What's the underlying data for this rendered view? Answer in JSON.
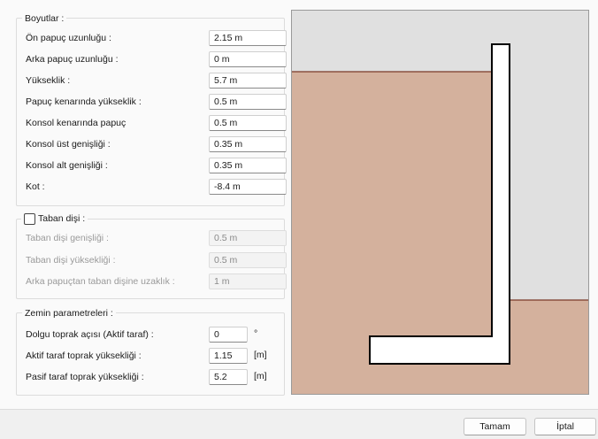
{
  "dimensions": {
    "title": "Boyutlar :",
    "fields": [
      {
        "label": "Ön papuç uzunluğu :",
        "value": "2.15 m"
      },
      {
        "label": "Arka papuç uzunluğu :",
        "value": "0 m"
      },
      {
        "label": "Yükseklik :",
        "value": "5.7 m"
      },
      {
        "label": "Papuç kenarında yükseklik :",
        "value": "0.5 m"
      },
      {
        "label": "Konsol kenarında papuç",
        "value": "0.5 m"
      },
      {
        "label": "Konsol üst genişliği :",
        "value": "0.35 m"
      },
      {
        "label": "Konsol alt genişliği :",
        "value": "0.35 m"
      },
      {
        "label": "Kot :",
        "value": "-8.4 m"
      }
    ]
  },
  "key": {
    "title": "Taban dişi :",
    "checked": false,
    "fields": [
      {
        "label": "Taban dişi genişliği :",
        "value": "0.5 m"
      },
      {
        "label": "Taban dişi yüksekliği :",
        "value": "0.5 m"
      },
      {
        "label": "Arka papuçtan taban dişine uzaklık :",
        "value": "1 m"
      }
    ]
  },
  "soil": {
    "title": "Zemin parametreleri :",
    "fields": [
      {
        "label": "Dolgu toprak açısı (Aktif taraf) :",
        "value": "0",
        "unit": "°"
      },
      {
        "label": "Aktif taraf toprak yüksekliği :",
        "value": "1.15",
        "unit": "[m]"
      },
      {
        "label": "Pasif taraf toprak yüksekliği :",
        "value": "5.2",
        "unit": "[m]"
      }
    ]
  },
  "preview": {
    "soil_color": "#d4b19d",
    "sky_color": "#e0e0e0",
    "wall_color": "#ffffff",
    "ground_line_color": "#7a3b28"
  },
  "buttons": {
    "ok": "Tamam",
    "cancel": "İptal"
  }
}
